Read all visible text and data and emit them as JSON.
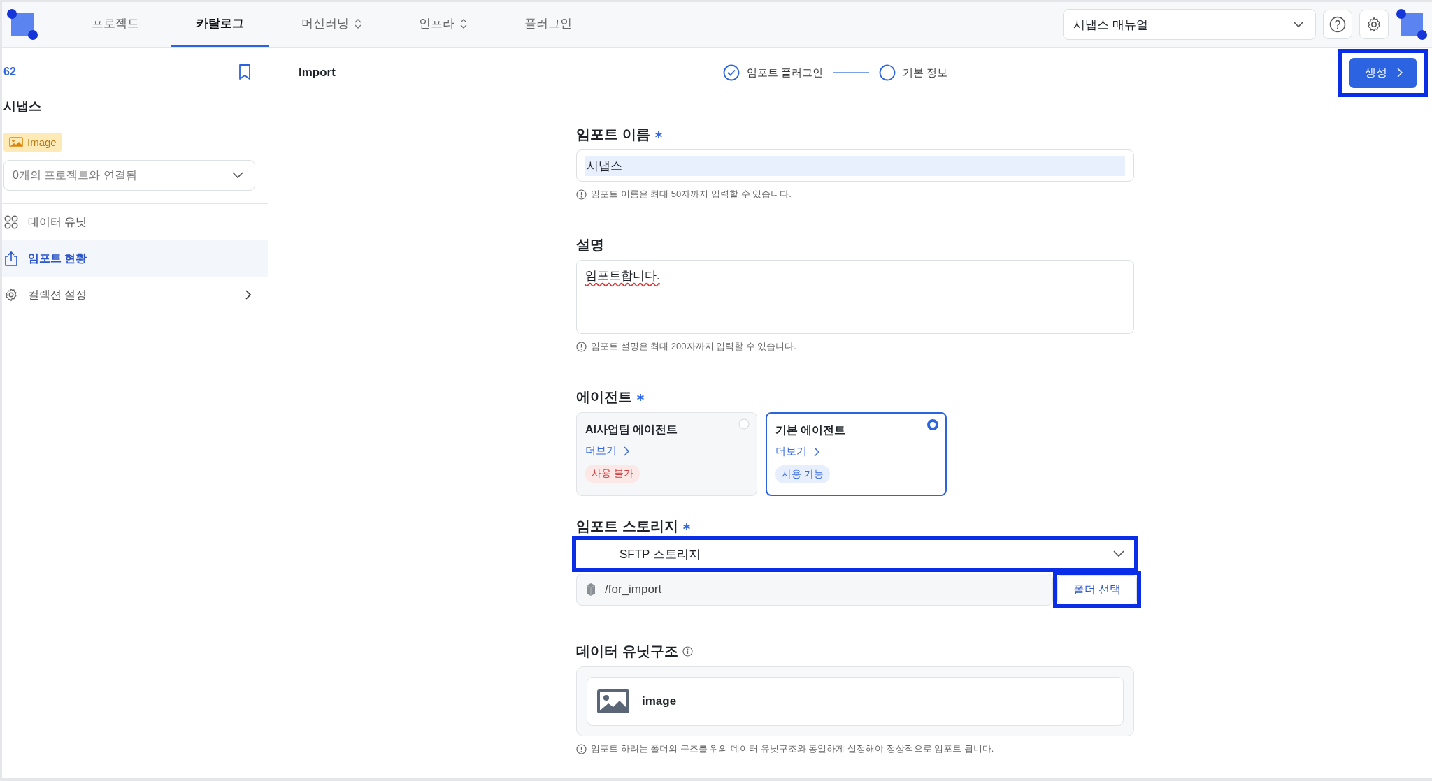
{
  "topbar": {
    "nav": [
      {
        "label": "프로젝트",
        "selected": false,
        "has_menu": false
      },
      {
        "label": "카탈로그",
        "selected": true,
        "has_menu": false
      },
      {
        "label": "머신러닝",
        "selected": false,
        "has_menu": true
      },
      {
        "label": "인프라",
        "selected": false,
        "has_menu": true
      },
      {
        "label": "플러그인",
        "selected": false,
        "has_menu": false
      }
    ],
    "manual_select": "시냅스 매뉴얼"
  },
  "sidebar": {
    "count": "62",
    "title": "시냅스",
    "type_badge": "Image",
    "project_select": "0개의 프로젝트와 연결됨",
    "menu": [
      {
        "label": "데이터 유닛",
        "kind": "grid",
        "selected": false,
        "has_arrow": false
      },
      {
        "label": "임포트 현황",
        "kind": "upload",
        "selected": true,
        "has_arrow": false
      },
      {
        "label": "컬렉션 설정",
        "kind": "gear",
        "selected": false,
        "has_arrow": true
      }
    ]
  },
  "header": {
    "title": "Import",
    "steps": [
      {
        "label": "임포트 플러그인",
        "done": true
      },
      {
        "label": "기본 정보",
        "done": false
      }
    ],
    "create_button": {
      "label": "생성",
      "highlighted": true
    }
  },
  "form": {
    "name": {
      "label": "임포트 이름",
      "required": true,
      "value": "시냅스",
      "hint": "임포트 이름은 최대 50자까지 입력할 수 있습니다."
    },
    "description": {
      "label": "설명",
      "value": "임포트합니다.",
      "hint": "임포트 설명은 최대 200자까지 입력할 수 있습니다."
    },
    "agent": {
      "label": "에이전트",
      "required": true,
      "options": [
        {
          "title": "AI사업팀 에이전트",
          "more": "더보기",
          "status": "사용 불가",
          "available": false,
          "selected": false
        },
        {
          "title": "기본 에이전트",
          "more": "더보기",
          "status": "사용 가능",
          "available": true,
          "selected": true
        }
      ]
    },
    "storage": {
      "label": "임포트 스토리지",
      "required": true,
      "value": "SFTP 스토리지",
      "highlighted": true,
      "path": "/for_import",
      "folder_button": {
        "label": "폴더 선택",
        "highlighted": true
      }
    },
    "structure": {
      "label": "데이터 유닛구조",
      "items": [
        {
          "name": "image"
        }
      ],
      "hint": "임포트 하려는 폴더의 구조를 위의 데이터 유닛구조와 동일하게 설정해야 정상적으로 임포트 됩니다."
    }
  }
}
